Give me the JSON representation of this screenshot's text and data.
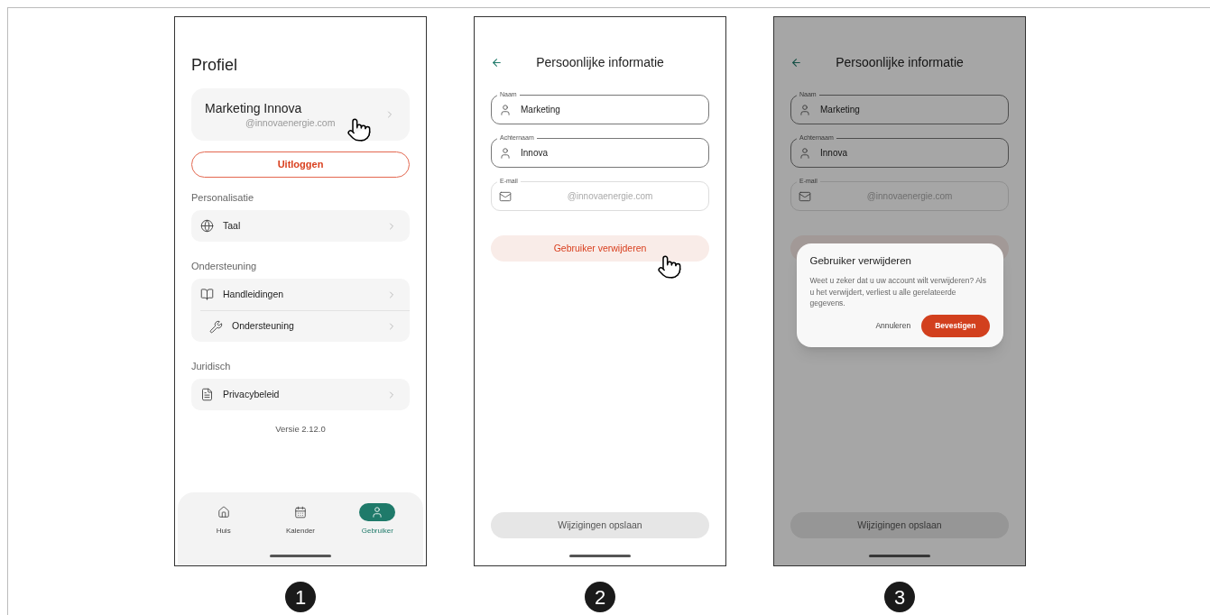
{
  "screens": [
    {
      "kind": "profile",
      "step": "1",
      "title": "Profiel",
      "account": {
        "name": "Marketing Innova",
        "email": "@innovaenergie.com"
      },
      "logout": "Uitloggen",
      "sections": [
        {
          "heading": "Personalisatie",
          "items": [
            {
              "label": "Taal"
            }
          ]
        },
        {
          "heading": "Ondersteuning",
          "items": [
            {
              "label": "Handleidingen"
            },
            {
              "label": "Ondersteuning"
            }
          ]
        },
        {
          "heading": "Juridisch",
          "items": [
            {
              "label": "Privacybeleid"
            }
          ]
        }
      ],
      "version": "Versie 2.12.0",
      "nav": [
        {
          "label": "Huis",
          "selected": false
        },
        {
          "label": "Kalender",
          "selected": false
        },
        {
          "label": "Gebruiker",
          "selected": true
        }
      ]
    },
    {
      "kind": "form",
      "step": "2",
      "title": "Persoonlijke informatie",
      "fields": [
        {
          "kind": "text",
          "label": "Naam",
          "value": "Marketing",
          "disabled": false
        },
        {
          "kind": "text",
          "label": "Achternaam",
          "value": "Innova",
          "disabled": false
        },
        {
          "kind": "email",
          "label": "E-mail",
          "value": "@innovaenergie.com",
          "disabled": true
        }
      ],
      "delete": "Gebruiker verwijderen",
      "save": "Wijzigingen opslaan"
    },
    {
      "kind": "form",
      "step": "3",
      "title": "Persoonlijke informatie",
      "fields": [
        {
          "kind": "text",
          "label": "Naam",
          "value": "Marketing",
          "disabled": false
        },
        {
          "kind": "text",
          "label": "Achternaam",
          "value": "Innova",
          "disabled": false
        },
        {
          "kind": "email",
          "label": "E-mail",
          "value": "@innovaenergie.com",
          "disabled": true
        }
      ],
      "save": "Wijzigingen opslaan",
      "dialog": {
        "title": "Gebruiker verwijderen",
        "message": "Weet u zeker dat u uw account wilt verwijderen? Als u het verwijdert, verliest u alle gerelateerde gegevens.",
        "cancel": "Annuleren",
        "confirm": "Bevestigen"
      }
    }
  ]
}
